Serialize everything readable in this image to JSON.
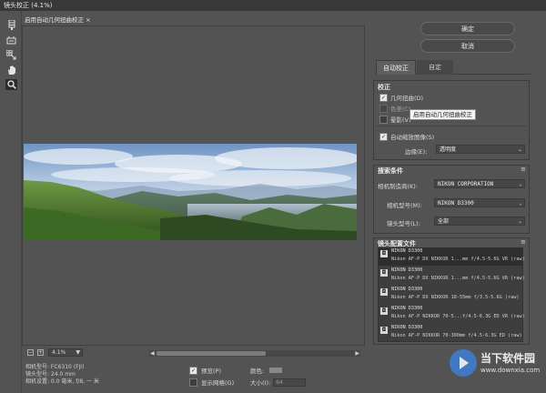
{
  "window": {
    "title": "镜头校正 (4.1%)"
  },
  "document_tab": {
    "label": "启用自动几何扭曲校正",
    "close": "×"
  },
  "tools": [
    {
      "icon": "remove-distortion-icon"
    },
    {
      "icon": "straighten-icon"
    },
    {
      "icon": "move-grid-icon"
    },
    {
      "icon": "hand-icon"
    },
    {
      "icon": "zoom-icon"
    }
  ],
  "zoom": {
    "minus": "−",
    "plus": "+",
    "value": "4.1%",
    "caret": "▼"
  },
  "camera_info": {
    "model": "相机型号: FC6310 (FJI)",
    "lens": "镜头型号: 24.0 mm",
    "settings": "相机设置: 0.0 毫米, f/8, 一 米"
  },
  "preview": {
    "label": "预览(P)",
    "checked": true
  },
  "show_grid": {
    "label": "显示网格(G)",
    "checked": false,
    "size_label": "大小(I):",
    "size_value": "64"
  },
  "color": {
    "label": "颜色:",
    "swatch": "#888888"
  },
  "buttons": {
    "ok": "确定",
    "cancel": "取消"
  },
  "tabs": [
    {
      "label": "自动校正",
      "active": true
    },
    {
      "label": "自定",
      "active": false
    }
  ],
  "correction": {
    "title": "校正",
    "geometric": {
      "label": "几何扭曲(D)",
      "checked": true
    },
    "chromatic": {
      "label": "色差(C)",
      "checked": false
    },
    "vignette": {
      "label": "晕影(V)",
      "checked": false
    },
    "auto_scale": {
      "label": "自动缩放图像(S)",
      "checked": true
    },
    "edge_label": "边缘(E):",
    "edge_value": "透明度"
  },
  "tooltip": "启用自动几何扭曲校正",
  "search": {
    "title": "搜索条件",
    "maker_label": "相机制造商(K):",
    "maker_value": "NIKON CORPORATION",
    "model_label": "相机型号(M):",
    "model_value": "NIKON D3300",
    "lens_label": "镜头型号(L):",
    "lens_value": "全部"
  },
  "profiles": {
    "title": "镜头配置文件",
    "items": [
      {
        "l1": "NIKON D3300",
        "l2": "Nikon AF-P DX NIKKOR 1...mm f/4.5-5.6G VR (raw)"
      },
      {
        "l1": "NIKON D3300",
        "l2": "Nikon AF-P DX NIKKOR 1...mm f/4.5-5.6G VR (raw)"
      },
      {
        "l1": "NIKON D3300",
        "l2": "Nikon AF-P DX NIKKOR 18-55mm f/3.5-5.6G (raw)"
      },
      {
        "l1": "NIKON D3300",
        "l2": "Nikon AF-P NIKKOR 70-5...f/4.5-6.3G ED VR (raw)"
      },
      {
        "l1": "NIKON D3300",
        "l2": "Nikon AF-P NIKKOR 70-300mm f/4.5-6.3G ED (raw)"
      }
    ]
  },
  "watermark": {
    "name": "当下软件园",
    "url": "www.downxia.com"
  },
  "menu_icon": "≡"
}
